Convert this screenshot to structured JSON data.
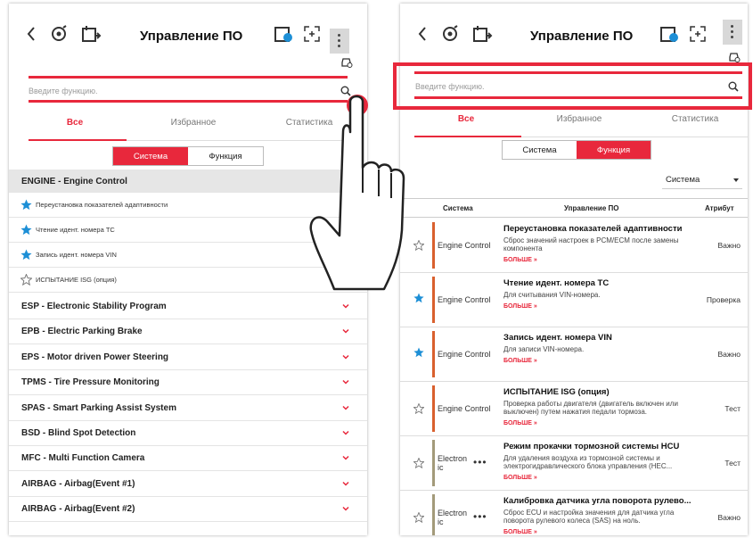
{
  "left": {
    "title": "Управление ПО",
    "search_placeholder": "Введите функцию.",
    "tabs": [
      "Все",
      "Избранное",
      "Статистика"
    ],
    "toggle": [
      "Система",
      "Функция"
    ],
    "section": "ENGINE - Engine Control",
    "sub_items": [
      {
        "label": "Переустановка показателей адаптивности",
        "fav": true
      },
      {
        "label": "Чтение идент. номера ТС",
        "fav": true
      },
      {
        "label": "Запись идент. номера VIN",
        "fav": true
      },
      {
        "label": "ИСПЫТАНИЕ ISG (опция)",
        "fav": false
      }
    ],
    "systems": [
      "ESP - Electronic Stability Program",
      "EPB - Electric Parking Brake",
      "EPS - Motor driven Power Steering",
      "TPMS - Tire Pressure Monitoring",
      "SPAS - Smart Parking Assist System",
      "BSD - Blind Spot Detection",
      "MFC - Multi Function Camera",
      "AIRBAG - Airbag(Event #1)",
      "AIRBAG - Airbag(Event #2)"
    ]
  },
  "right": {
    "title": "Управление ПО",
    "search_placeholder": "Введите функцию.",
    "tabs": [
      "Все",
      "Избранное",
      "Статистика"
    ],
    "toggle": [
      "Система",
      "Функция"
    ],
    "dropdown": "Система",
    "columns": [
      "Система",
      "Управление ПО",
      "Атрибут"
    ],
    "more_label": "БОЛЬШЕ »",
    "rows": [
      {
        "sys": "Engine Control",
        "name": "Переустановка показателей адаптивности",
        "desc": "Сброс значений настроек в PCM/ECM после замены компонента",
        "attr": "Важно",
        "fav": false
      },
      {
        "sys": "Engine Control",
        "name": "Чтение идент. номера ТС",
        "desc": "Для считывания VIN-номера.",
        "attr": "Проверка",
        "fav": true
      },
      {
        "sys": "Engine Control",
        "name": "Запись идент. номера VIN",
        "desc": "Для записи VIN-номера.",
        "attr": "Важно",
        "fav": true
      },
      {
        "sys": "Engine Control",
        "name": "ИСПЫТАНИЕ ISG (опция)",
        "desc": "Проверка работы двигателя (двигатель включен или выключен) путем нажатия педали тормоза.",
        "attr": "Тест",
        "fav": false
      },
      {
        "sys": "Electron ic",
        "name": "Режим прокачки тормозной системы HCU",
        "desc": "Для удаления воздуха из тормозной системы и электрогидравлического блока управления (HEC...",
        "attr": "Тест",
        "fav": false
      },
      {
        "sys": "Electron ic",
        "name": "Калибровка датчика угла поворота рулево...",
        "desc": "Сброс ECU и настройка значения для датчика угла поворота рулевого колеса (SAS) на ноль.",
        "attr": "Важно",
        "fav": false
      }
    ]
  },
  "colors": {
    "accent": "#e8283c",
    "star": "#1d8fd6",
    "bar_engine": "#d9602e",
    "bar_electronic": "#a39a7a"
  }
}
